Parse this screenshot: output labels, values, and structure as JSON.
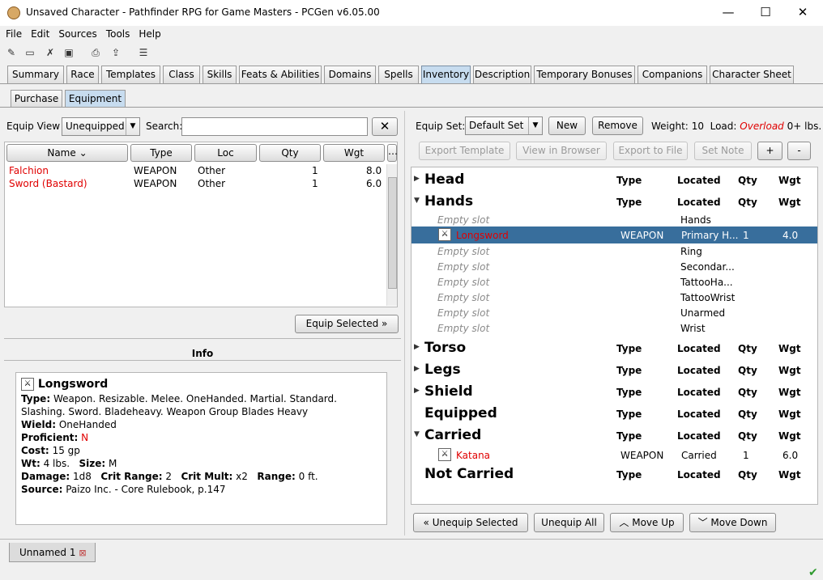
{
  "window": {
    "title": "Unsaved Character - Pathfinder RPG for Game Masters - PCGen v6.05.00"
  },
  "menu": [
    "File",
    "Edit",
    "Sources",
    "Tools",
    "Help"
  ],
  "tabs": [
    "Summary",
    "Race",
    "Templates",
    "Class",
    "Skills",
    "Feats & Abilities",
    "Domains",
    "Spells",
    "Inventory",
    "Description",
    "Temporary Bonuses",
    "Companions",
    "Character Sheet"
  ],
  "subtabs": [
    "Purchase",
    "Equipment"
  ],
  "left": {
    "equip_view_label": "Equip View",
    "equip_view_value": "Unequipped",
    "search_label": "Search:",
    "search_value": "",
    "columns": [
      "Name",
      "Type",
      "Loc",
      "Qty",
      "Wgt"
    ],
    "rows": [
      {
        "name": "Falchion",
        "type": "WEAPON",
        "loc": "Other",
        "qty": "1",
        "wgt": "8.0"
      },
      {
        "name": "Sword (Bastard)",
        "type": "WEAPON",
        "loc": "Other",
        "qty": "1",
        "wgt": "6.0"
      }
    ],
    "equip_selected": "Equip Selected",
    "info_title": "Info"
  },
  "info": {
    "name": "Longsword",
    "type_label": "Type:",
    "type_value": "Weapon. Resizable. Melee. OneHanded. Martial. Standard. Slashing. Sword. Bladeheavy. Weapon Group Blades Heavy",
    "wield_label": "Wield:",
    "wield_value": "OneHanded",
    "prof_label": "Proficient:",
    "prof_value": "N",
    "cost_label": "Cost:",
    "cost_value": "15 gp",
    "wt_label": "Wt:",
    "wt_value": "4 lbs.",
    "size_label": "Size:",
    "size_value": "M",
    "dmg_label": "Damage:",
    "dmg_value": "1d8",
    "crit_label": "Crit Range:",
    "crit_value": "2",
    "mult_label": "Crit Mult:",
    "mult_value": "x2",
    "range_label": "Range:",
    "range_value": "0 ft.",
    "source_label": "Source:",
    "source_value": "Paizo Inc. - Core Rulebook, p.147"
  },
  "right": {
    "equip_set_label": "Equip Set:",
    "equip_set_value": "Default Set",
    "new": "New",
    "remove": "Remove",
    "weight_label": "Weight:",
    "weight_value": "10",
    "load_label": "Load:",
    "load_value": "Overload",
    "load_suffix": "0+ lbs.",
    "export_template": "Export Template",
    "view_browser": "View in Browser",
    "export_file": "Export to File",
    "set_note": "Set Note",
    "plus": "+",
    "minus": "-",
    "col_type": "Type",
    "col_located": "Located",
    "col_qty": "Qty",
    "col_wgt": "Wgt",
    "groups": {
      "head": "Head",
      "hands": "Hands",
      "torso": "Torso",
      "legs": "Legs",
      "shield": "Shield",
      "equipped": "Equipped",
      "carried": "Carried",
      "not_carried": "Not Carried"
    },
    "empty_slot": "Empty slot",
    "slots": [
      "Hands",
      "Ring",
      "Secondar...",
      "TattooHa...",
      "TattooWrist",
      "Unarmed",
      "Wrist"
    ],
    "longsword": {
      "name": "Longsword",
      "type": "WEAPON",
      "loc": "Primary H...",
      "qty": "1",
      "wgt": "4.0"
    },
    "katana": {
      "name": "Katana",
      "type": "WEAPON",
      "loc": "Carried",
      "qty": "1",
      "wgt": "6.0"
    },
    "unequip_selected": "Unequip Selected",
    "unequip_all": "Unequip All",
    "move_up": "Move Up",
    "move_down": "Move Down"
  },
  "status": {
    "character_tab": "Unnamed 1"
  }
}
